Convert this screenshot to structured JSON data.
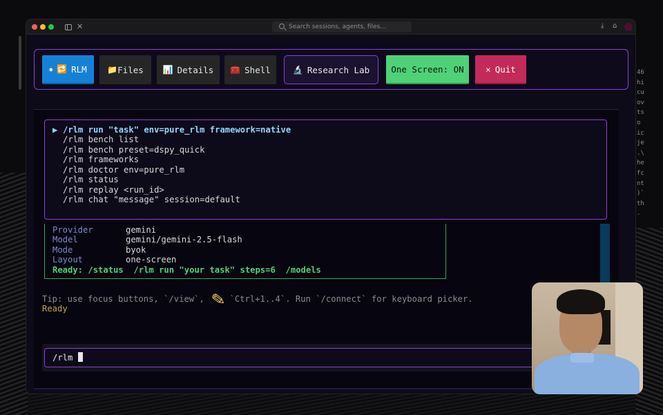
{
  "titlebar": {
    "search_placeholder": "Search sessions, agents, files..."
  },
  "toolbar": {
    "buttons": [
      {
        "label": "RLM",
        "icon": "🔁",
        "active": true
      },
      {
        "label": "Files",
        "icon": "📁"
      },
      {
        "label": "Details",
        "icon": "📊"
      },
      {
        "label": "Shell",
        "icon": "🧰"
      },
      {
        "label": "Research Lab",
        "icon": "🔬"
      },
      {
        "label": "One Screen: ON"
      },
      {
        "label": "Quit",
        "icon": "×"
      }
    ]
  },
  "command_menu": {
    "selected_marker": "▶",
    "items": [
      "/rlm run \"task\" env=pure_rlm framework=native",
      "/rlm bench list",
      "/rlm bench preset=dspy_quick",
      "/rlm frameworks",
      "/rlm doctor env=pure_rlm",
      "/rlm status",
      "/rlm replay <run_id>",
      "/rlm chat \"message\" session=default"
    ]
  },
  "info_panel": {
    "rows": [
      {
        "key": "Provider",
        "value": "gemini"
      },
      {
        "key": "Model",
        "value": "gemini/gemini-2.5-flash"
      },
      {
        "key": "Mode",
        "value": "byok"
      },
      {
        "key": "Layout",
        "value": "one-screen"
      }
    ],
    "ready_line": "Ready: /status  /rlm run \"your task\" steps=6  /models"
  },
  "tip": "Tip: use focus buttons, `/view`,     `Ctrl+1..4`. Run `/connect` for keyboard picker.",
  "status": "Ready",
  "input": {
    "value": "/rlm "
  },
  "side_text": [
    "46",
    "hi",
    "cu",
    "ov",
    "ts",
    "o",
    "ic",
    "je",
    ".\\",
    "he",
    "fc",
    "nt",
    ")`",
    "th",
    "."
  ],
  "colors": {
    "accent": "#8b3fd6",
    "rlm_button": "#1581d6",
    "one_screen_button": "#4fd177",
    "quit_button": "#c22a5a",
    "ready_green": "#4fd177"
  }
}
